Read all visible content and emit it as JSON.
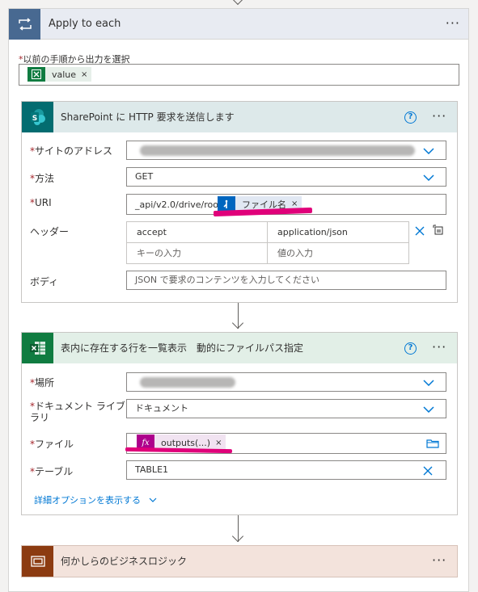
{
  "loop": {
    "title": "Apply to each",
    "more_label": "···",
    "select_label": "以前の手順から出力を選択",
    "required_mark": "*",
    "token": {
      "label": "value",
      "close": "×"
    }
  },
  "sharepoint": {
    "title": "SharePoint に HTTP 要求を送信します",
    "more_label": "···",
    "help": "?",
    "fields": {
      "site_label": "サイトのアドレス",
      "method_label": "方法",
      "method_value": "GET",
      "uri_label": "URI",
      "uri_value": "_api/v2.0/drive/root:/",
      "uri_token_label": "ファイル名",
      "uri_token_close": "×",
      "headers_label": "ヘッダー",
      "header_key": "accept",
      "header_value": "application/json",
      "header_key_placeholder": "キーの入力",
      "header_value_placeholder": "値の入力",
      "body_label": "ボディ",
      "body_placeholder": "JSON で要求のコンテンツを入力してください"
    }
  },
  "excel": {
    "title": "表内に存在する行を一覧表示　動的にファイルパス指定",
    "more_label": "···",
    "help": "?",
    "fields": {
      "location_label": "場所",
      "library_label_line1": "ドキュメント ライブ",
      "library_label_line2": "ラリ",
      "library_value": "ドキュメント",
      "file_label": "ファイル",
      "file_token_label": "outputs(...)",
      "file_token_close": "×",
      "table_label": "テーブル",
      "table_value": "TABLE1",
      "advanced_link": "詳細オプションを表示する"
    }
  },
  "logic": {
    "title": "何かしらのビジネスロジック",
    "more_label": "···"
  },
  "colors": {
    "loop_accent": "#486991",
    "sharepoint_accent": "#036c70",
    "excel_accent": "#107c41",
    "logic_accent": "#8c3b11",
    "highlight": "#e0007a"
  }
}
